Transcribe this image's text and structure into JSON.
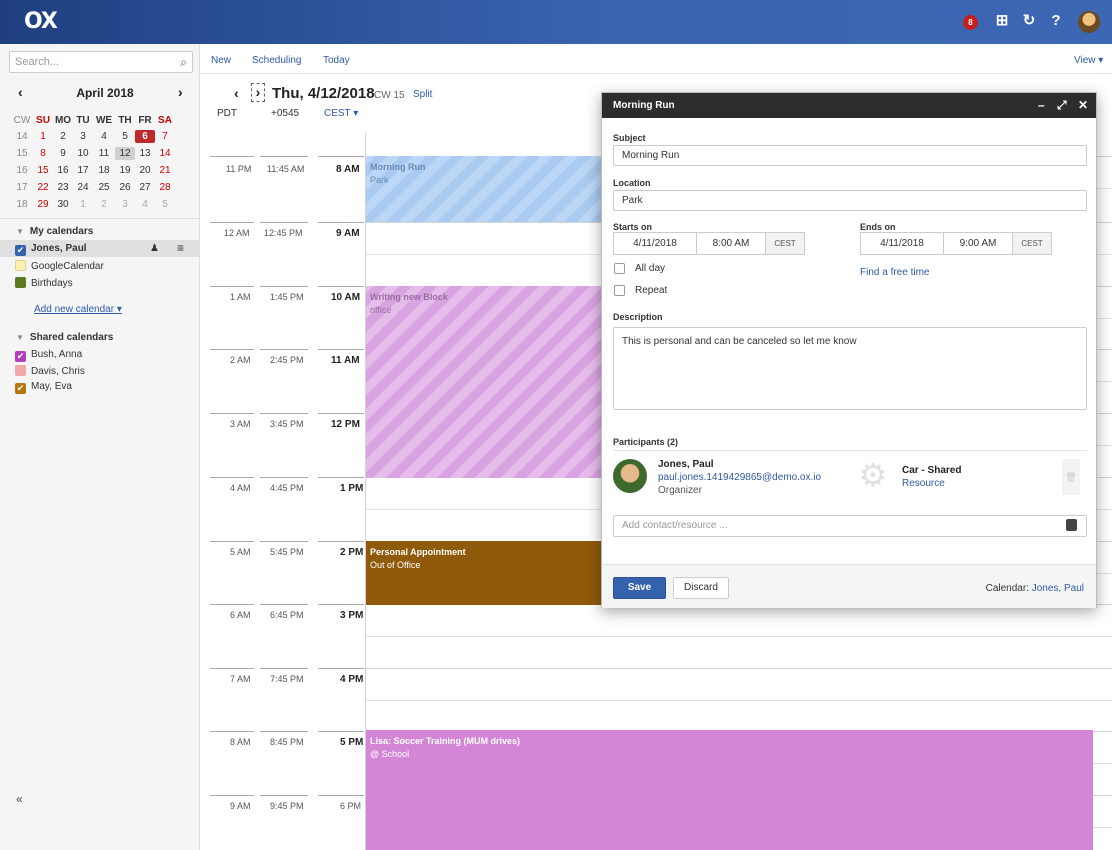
{
  "app": {
    "logo": "OX",
    "notifications": "8"
  },
  "header": {
    "apps_icon": "grid-icon",
    "refresh_icon": "refresh-icon",
    "help_icon": "help-icon"
  },
  "sidebar": {
    "search_placeholder": "Search...",
    "mini_calendar": {
      "title": "April 2018",
      "headers": [
        "CW",
        "SU",
        "MO",
        "TU",
        "WE",
        "TH",
        "FR",
        "SA"
      ],
      "weeks": [
        [
          "14",
          "1",
          "2",
          "3",
          "4",
          "5",
          "6",
          "7"
        ],
        [
          "15",
          "8",
          "9",
          "10",
          "11",
          "12",
          "13",
          "14"
        ],
        [
          "16",
          "15",
          "16",
          "17",
          "18",
          "19",
          "20",
          "21"
        ],
        [
          "17",
          "22",
          "23",
          "24",
          "25",
          "26",
          "27",
          "28"
        ],
        [
          "18",
          "29",
          "30",
          "1",
          "2",
          "3",
          "4",
          "5"
        ]
      ],
      "today": "6",
      "selected": "12"
    },
    "my_calendars_label": "My calendars",
    "my_calendars": [
      {
        "name": "Jones, Paul",
        "color": "#3561ad",
        "checked": true
      },
      {
        "name": "GoogleCalendar",
        "color": "#fcefb0",
        "checked": false
      },
      {
        "name": "Birthdays",
        "color": "#5c7a1f",
        "checked": false
      }
    ],
    "add_calendar": "Add new calendar",
    "shared_calendars_label": "Shared calendars",
    "shared_calendars": [
      {
        "name": "Bush, Anna",
        "color": "#b33fb8",
        "checked": true
      },
      {
        "name": "Davis, Chris",
        "color": "#f0a7a7",
        "checked": false
      },
      {
        "name": "May, Eva",
        "color": "#b5760e",
        "checked": true
      }
    ],
    "collapse": "«"
  },
  "toolbar": {
    "new": "New",
    "scheduling": "Scheduling",
    "today": "Today",
    "view": "View"
  },
  "day": {
    "title": "Thu, 4/12/2018",
    "cw": "CW 15",
    "split": "Split",
    "timezones": [
      "PDT",
      "+0545",
      "CEST"
    ]
  },
  "times": {
    "pdt": [
      "11 PM",
      "12 AM",
      "1 AM",
      "2 AM",
      "3 AM",
      "4 AM",
      "5 AM",
      "6 AM",
      "7 AM",
      "8 AM",
      "9 AM"
    ],
    "np": [
      "11:45 AM",
      "12:45 PM",
      "1:45 PM",
      "2:45 PM",
      "3:45 PM",
      "4:45 PM",
      "5:45 PM",
      "6:45 PM",
      "7:45 PM",
      "8:45 PM",
      "9:45 PM"
    ],
    "cest": [
      "8 AM",
      "9 AM",
      "10 AM",
      "11 AM",
      "12 PM",
      "1 PM",
      "2 PM",
      "3 PM",
      "4 PM",
      "5 PM",
      "6 PM"
    ]
  },
  "events": {
    "run": {
      "title": "Morning Run",
      "location": "Park"
    },
    "block": {
      "title": "Writing new Block",
      "location": "office"
    },
    "personal": {
      "title": "Personal Appointment",
      "location": "Out of Office"
    },
    "soccer": {
      "title": "Lisa: Soccer Training (MUM drives)",
      "location": "@ School"
    }
  },
  "dialog": {
    "title": "Morning Run",
    "subject_label": "Subject",
    "subject": "Morning Run",
    "location_label": "Location",
    "location": "Park",
    "starts_label": "Starts on",
    "start_date": "4/11/2018",
    "start_time": "8:00 AM",
    "start_tz": "CEST",
    "ends_label": "Ends on",
    "end_date": "4/11/2018",
    "end_time": "9:00 AM",
    "end_tz": "CEST",
    "allday": "All day",
    "repeat": "Repeat",
    "find_free": "Find a free time",
    "description_label": "Description",
    "description": "This is personal and can be canceled so let me know",
    "participants_label": "Participants (2)",
    "participant": {
      "name": "Jones, Paul",
      "email": "paul.jones.1419429865@demo.ox.io",
      "role": "Organizer"
    },
    "resource": {
      "name": "Car - Shared",
      "type": "Resource"
    },
    "add_placeholder": "Add contact/resource ...",
    "save": "Save",
    "discard": "Discard",
    "calendar_label": "Calendar:",
    "calendar_value": "Jones, Paul"
  }
}
